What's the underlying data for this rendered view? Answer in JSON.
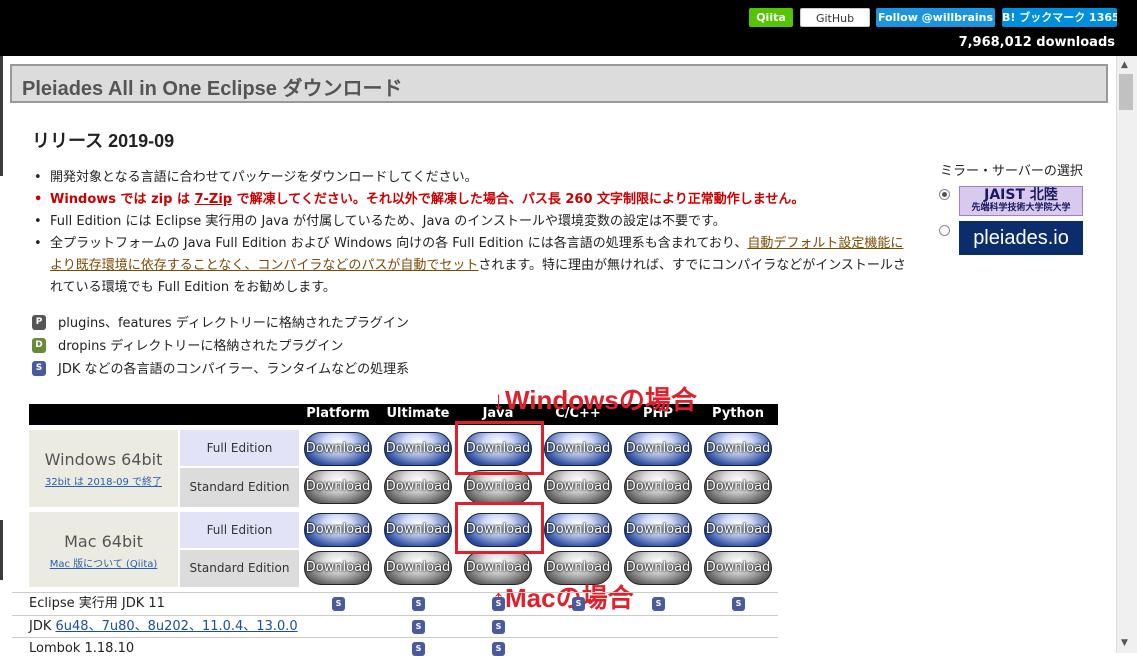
{
  "topbar": {
    "qiita": "Qiita",
    "github": "GitHub",
    "twitter": "Follow @willbrains",
    "hatena": "B! ブックマーク 1365",
    "downloads": "7,968,012 downloads"
  },
  "page": {
    "title": "Pleiades All in One Eclipse ダウンロード",
    "release": "リリース 2019-09"
  },
  "bullets": {
    "b1": "開発対象となる言語に合わせてパッケージをダウンロードしてください。",
    "b2_a": "Windows では zip は ",
    "b2_link": "7-Zip",
    "b2_b": " で解凍してください。それ以外で解凍した場合、パス長 260 文字制限により正常動作しません。",
    "b3": "Full Edition には Eclipse 実行用の Java が付属しているため、Java のインストールや環境変数の設定は不要です。",
    "b4_a": "全プラットフォームの Java Full Edition および Windows 向けの各 Full Edition には各言語の処理系も含まれており、",
    "b4_link": "自動デフォルト設定機能により既存環境に依存することなく、コンパイラなどのパスが自動でセット",
    "b4_b": "されます。特に理由が無ければ、すでにコンパイラなどがインストールされている環境でも Full Edition をお勧めします。"
  },
  "legend": [
    {
      "icon": "P",
      "text": "plugins、features ディレクトリーに格納されたプラグイン"
    },
    {
      "icon": "D",
      "text": "dropins ディレクトリーに格納されたプラグイン"
    },
    {
      "icon": "S",
      "text": "JDK などの各言語のコンパイラー、ランタイムなどの処理系"
    }
  ],
  "mirror": {
    "title": "ミラー・サーバーの選択",
    "jaist_main": "JAIST 北陸",
    "jaist_sub": "先端科学技術大学院大学",
    "pleiades": "pleiades.io"
  },
  "table": {
    "columns": [
      "Platform",
      "Ultimate",
      "Java",
      "C/C++",
      "PHP",
      "Python"
    ],
    "windows": {
      "name": "Windows 64bit",
      "note": "32bit は 2018-09 で終了"
    },
    "mac": {
      "name": "Mac 64bit",
      "note": "Mac 版について (Qiita)"
    },
    "full_edition": "Full Edition",
    "standard_edition": "Standard Edition",
    "download_label": "Download"
  },
  "annotations": {
    "windows": "↓Windowsの場合",
    "mac": "↑Macの場合"
  },
  "info_rows": {
    "eclipse_jdk": "Eclipse 実行用 JDK 11",
    "jdk_label": "JDK ",
    "jdk_links": "6u48、7u80、8u202、11.0.4、13.0.0",
    "lombok": "Lombok 1.18.10"
  },
  "colors": {
    "annotation_red": "#e0202a",
    "qiita_green": "#55c500",
    "twitter_blue": "#1b95e0"
  }
}
